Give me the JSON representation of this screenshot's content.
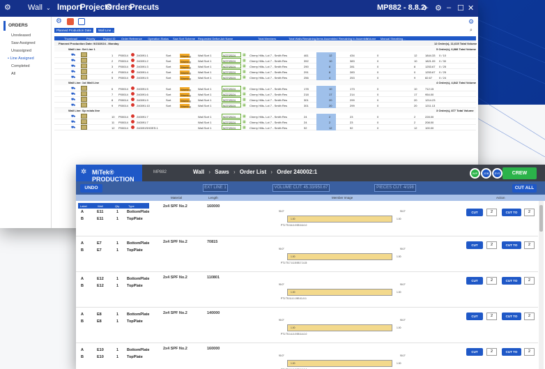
{
  "back_window": {
    "app_icon": "gear-icon",
    "title": "Wall",
    "menus": [
      "Import",
      "Projects",
      "Orders",
      "Precuts"
    ],
    "version": "MP882 - 8.8.2",
    "sidebar_header": "ORDERS",
    "sidebar_items": [
      "Unreleased",
      "Saw Assigned",
      "Unassigned",
      "Line Assigned",
      "Completed",
      "All"
    ],
    "filters": [
      "Planned Production Date",
      "Wall Line"
    ],
    "columns": [
      "Thumbnail",
      "Priority",
      "Project ID",
      "Order Reference",
      "Operation Status",
      "Saw Sort Scheme",
      "Requested Delive...",
      "Job Name",
      "Total Members",
      "Total Walls",
      "Remaining...",
      "Items Assembled",
      "Remaining to Assemble",
      "Volume",
      "Manual Sheathing..."
    ],
    "group_date": "Planned Production Date: 9/23/2024 - Monday",
    "group_date_summary": "12 Order(s), 11,615 Total Volume",
    "lines": [
      {
        "label": "Wall Line: Set Line 1",
        "summary": "5 Order(s), 6,888 Total Volume",
        "rows": [
          {
            "priority": "1",
            "project": "P00014",
            "order": "240091:1",
            "status": "Sort",
            "warn": "Warning",
            "scheme": "Wall Sort 1",
            "date": "9/27/2024",
            "job": "Cherry Hills- Lot 7 - Smith Res",
            "members": "461",
            "walls": "12",
            "rem": "434",
            "assembled": "0",
            "toasm": "12",
            "vol": "1844.33",
            "sheath": "0 / 10"
          },
          {
            "priority": "2",
            "project": "P00014",
            "order": "240091:2",
            "status": "Sort",
            "warn": "Warning",
            "scheme": "Wall Sort 1",
            "date": "9/27/2024",
            "job": "Cherry Hills- Lot 7 - Smith Res",
            "members": "392",
            "walls": "10",
            "rem": "383",
            "assembled": "0",
            "toasm": "10",
            "vol": "1821.09",
            "sheath": "0 / 30"
          },
          {
            "priority": "3",
            "project": "P00014",
            "order": "240091:3",
            "status": "Sort",
            "warn": "Warning",
            "scheme": "Wall Sort 1",
            "date": "9/27/2024",
            "job": "Cherry Hills- Lot 7 - Smith Res",
            "members": "290",
            "walls": "8",
            "rem": "281",
            "assembled": "0",
            "toasm": "8",
            "vol": "1253.67",
            "sheath": "0 / 25"
          },
          {
            "priority": "4",
            "project": "P00014",
            "order": "240091:4",
            "status": "Sort",
            "warn": "Warning",
            "scheme": "Wall Sort 1",
            "date": "9/27/2024",
            "job": "Cherry Hills- Lot 7 - Smith Res",
            "members": "291",
            "walls": "8",
            "rem": "283",
            "assembled": "0",
            "toasm": "0",
            "vol": "1253.67",
            "sheath": "0 / 25"
          },
          {
            "priority": "5",
            "project": "P00014",
            "order": "240091:5",
            "status": "Sort",
            "warn": "Warning",
            "scheme": "Wall Sort 1",
            "date": "9/27/2024",
            "job": "Cherry Hills- Lot 7 - Smith Res",
            "members": "256",
            "walls": "4",
            "rem": "253",
            "assembled": "0",
            "toasm": "9",
            "vol": "82.67",
            "sheath": "0 / 24"
          }
        ]
      },
      {
        "label": "Wall Line: 1st Wall Line",
        "summary": "4 Order(s), 4,842 Total Volume",
        "rows": [
          {
            "priority": "6",
            "project": "P00014",
            "order": "240091:5",
            "status": "Sort",
            "warn": "Warning",
            "scheme": "Wall Sort 1",
            "date": "9/27/2024",
            "job": "Cherry Hills- Lot 7 - Smith Res",
            "members": "178",
            "walls": "10",
            "rem": "173",
            "assembled": "0",
            "toasm": "10",
            "vol": "712.15",
            "sheath": ""
          },
          {
            "priority": "7",
            "project": "P00014",
            "order": "240091:6",
            "status": "Sort",
            "warn": "Warning",
            "scheme": "Wall Sort 1",
            "date": "9/27/2024",
            "job": "Cherry Hills- Lot 7 - Smith Res",
            "members": "218",
            "walls": "17",
            "rem": "214",
            "assembled": "0",
            "toasm": "17",
            "vol": "954.00",
            "sheath": ""
          },
          {
            "priority": "8",
            "project": "P00014",
            "order": "240091:9",
            "status": "Sort",
            "warn": "Warning",
            "scheme": "Wall Sort 1",
            "date": "9/27/2024",
            "job": "Cherry Hills- Lot 7 - Smith Res",
            "members": "301",
            "walls": "20",
            "rem": "299",
            "assembled": "0",
            "toasm": "20",
            "vol": "1214.23",
            "sheath": ""
          },
          {
            "priority": "9",
            "project": "P00014",
            "order": "240091:10",
            "status": "Sort",
            "warn": "Warning",
            "scheme": "Wall Sort 1",
            "date": "9/27/2024",
            "job": "Cherry Hills- Lot 7 - Smith Res",
            "members": "301",
            "walls": "20",
            "rem": "299",
            "assembled": "0",
            "toasm": "20",
            "vol": "1211.13",
            "sheath": ""
          }
        ]
      },
      {
        "label": "Wall Line: Sp ecials line",
        "summary": "3 Order(s), 877 Total Volume",
        "rows": [
          {
            "priority": "10",
            "project": "P00014",
            "order": "240091:7",
            "status": "",
            "warn": "",
            "scheme": "Wall Sort 1",
            "date": "9/27/2024",
            "job": "Cherry Hills- Lot 7 - Smith Res",
            "members": "24",
            "walls": "2",
            "rem": "23",
            "assembled": "0",
            "toasm": "2",
            "vol": "228.00",
            "sheath": ""
          },
          {
            "priority": "11",
            "project": "P00014",
            "order": "240091:7",
            "status": "",
            "warn": "",
            "scheme": "Wall Sort 1",
            "date": "9/27/2024",
            "job": "Cherry Hills- Lot 7 - Smith Res",
            "members": "24",
            "walls": "2",
            "rem": "23",
            "assembled": "0",
            "toasm": "2",
            "vol": "208.00",
            "sheath": ""
          },
          {
            "priority": "12",
            "project": "P00014",
            "order": "240091SHOES:1",
            "status": "",
            "warn": "",
            "scheme": "Wall Sort 1",
            "date": "9/27/2024",
            "job": "Cherry Hills- Lot 7 - Smith Res",
            "members": "92",
            "walls": "12",
            "rem": "92",
            "assembled": "0",
            "toasm": "12",
            "vol": "100.00",
            "sheath": ""
          }
        ]
      }
    ]
  },
  "front_window": {
    "brand": "MiTek® PRODUCTION",
    "station": "MP882",
    "breadcrumb": [
      "Wall",
      "Saws",
      "Order List",
      "Order 240002:1"
    ],
    "circles": [
      "WIP",
      "JOB",
      "SYS"
    ],
    "crew": "CREW",
    "undo": "UNDO",
    "ext_line": "EXT LINE 1",
    "volume_cut": "VOLUME CUT: 45.33/950.67",
    "pieces_cut": "PIECES CUT: 4/198",
    "cut_all": "CUT ALL",
    "col_headers": {
      "material": "Material",
      "length": "Length",
      "image": "Member Image",
      "action": "Action"
    },
    "sub_headers": [
      "Label",
      "Wall",
      "Qty",
      "Type"
    ],
    "cut_label": "CUT",
    "cut_to_label": "CUT TO",
    "blocks": [
      {
        "rows": [
          {
            "label": "A",
            "wall": "E11",
            "qty": "1",
            "type": "BottomPlate"
          },
          {
            "label": "B",
            "wall": "E11",
            "qty": "1",
            "type": "TopPlate"
          }
        ],
        "material": "2x4 SPF No.2",
        "length": "160000",
        "dim_left": "90.0°",
        "dim_right": "90.0°",
        "thk": "1.00",
        "note": "PT1 TS:16-0-0 BS:16-0-0",
        "n1": "2",
        "n2": "2"
      },
      {
        "rows": [
          {
            "label": "A",
            "wall": "E7",
            "qty": "1",
            "type": "BottomPlate"
          },
          {
            "label": "B",
            "wall": "E7",
            "qty": "1",
            "type": "TopPlate"
          }
        ],
        "material": "2x4 SPF No.2",
        "length": "70815",
        "dim_left": "90.0°",
        "dim_right": "90.0°",
        "thk": "1.00",
        "note": "PT1 TS:7-0-15 BS:7-0-15",
        "n1": "2",
        "n2": "2"
      },
      {
        "rows": [
          {
            "label": "A",
            "wall": "E12",
            "qty": "1",
            "type": "BottomPlate"
          },
          {
            "label": "B",
            "wall": "E12",
            "qty": "1",
            "type": "TopPlate"
          }
        ],
        "material": "2x4 SPF No.2",
        "length": "110801",
        "dim_left": "90.0°",
        "dim_right": "90.0°",
        "thk": "1.00",
        "note": "PT1 TS:11-0-1 BS:11-0-1",
        "n1": "2",
        "n2": "2"
      },
      {
        "rows": [
          {
            "label": "A",
            "wall": "E8",
            "qty": "1",
            "type": "BottomPlate"
          },
          {
            "label": "B",
            "wall": "E8",
            "qty": "1",
            "type": "TopPlate"
          }
        ],
        "material": "2x4 SPF No.2",
        "length": "140000",
        "dim_left": "90.0°",
        "dim_right": "90.0°",
        "thk": "1.00",
        "note": "PT1 TS:14-0-0 BS:14-0-0",
        "n1": "2",
        "n2": "2"
      },
      {
        "rows": [
          {
            "label": "A",
            "wall": "E10",
            "qty": "1",
            "type": "BottomPlate"
          },
          {
            "label": "B",
            "wall": "E10",
            "qty": "1",
            "type": "TopPlate"
          }
        ],
        "material": "2x4 SPF No.2",
        "length": "160000",
        "dim_left": "90.0°",
        "dim_right": "90.0°",
        "thk": "1.00",
        "note": "PT1 TS:16-0-0 BS:16-0-0",
        "n1": "2",
        "n2": "2"
      }
    ]
  }
}
